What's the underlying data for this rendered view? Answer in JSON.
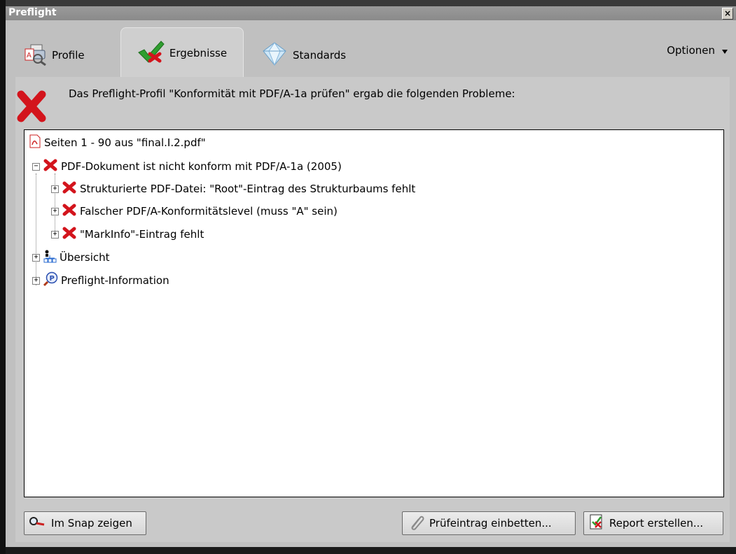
{
  "window": {
    "title": "Preflight",
    "close_label": "×"
  },
  "tabs": [
    {
      "label": "Profile",
      "icon": "profile-icon"
    },
    {
      "label": "Ergebnisse",
      "icon": "checkmark-icon"
    },
    {
      "label": "Standards",
      "icon": "diamond-icon"
    }
  ],
  "options": {
    "label": "Optionen"
  },
  "message": {
    "text": "Das Preflight-Profil \"Konformität mit PDF/A-1a prüfen\" ergab die folgenden Probleme:",
    "icon": "error-x-icon"
  },
  "tree": {
    "root": "Seiten 1 - 90 aus \"final.I.2.pdf\"",
    "group": "PDF-Dokument ist nicht konform mit PDF/A-1a (2005)",
    "problems": [
      "Strukturierte PDF-Datei: \"Root\"-Eintrag des Strukturbaums fehlt",
      "Falscher PDF/A-Konformitätslevel (muss \"A\" sein)",
      "\"MarkInfo\"-Eintrag fehlt"
    ],
    "overview": "Übersicht",
    "info": "Preflight-Information"
  },
  "buttons": {
    "snap": "Im Snap zeigen",
    "embed": "Prüfeintrag einbetten...",
    "report": "Report erstellen..."
  },
  "colors": {
    "error_red": "#d3141c",
    "check_green": "#2f9e2f",
    "panel_gray": "#c9c9c9"
  }
}
